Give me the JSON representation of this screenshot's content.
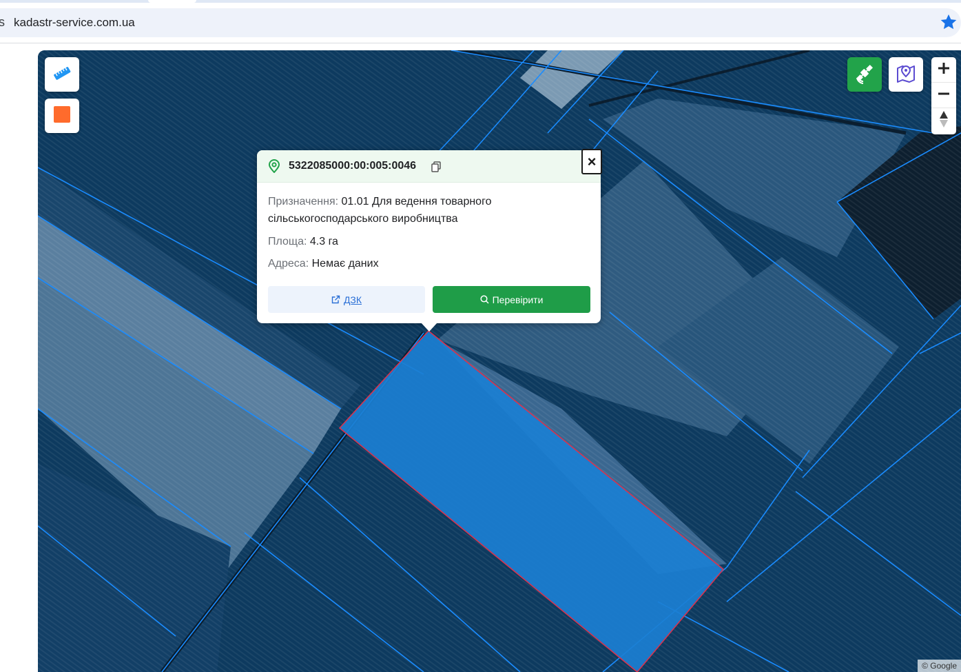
{
  "browser": {
    "address_fragment": "s",
    "url": "kadastr-service.com.ua"
  },
  "map": {
    "attribution": "© Google",
    "controls": {
      "measure_icon": "ruler-icon",
      "draw_icon": "square-icon",
      "satellite_icon": "satellite-icon",
      "map_layer_icon": "map-pin-icon",
      "zoom_in_icon": "plus-icon",
      "zoom_out_icon": "minus-icon",
      "compass_icon": "compass-icon"
    },
    "colors": {
      "selected_parcel": "#1b7fd3",
      "parcel_lines": "#1a8cff",
      "selected_outline": "#e0304a"
    }
  },
  "popup": {
    "cadastral_number": "5322085000:00:005:0046",
    "close_label": "×",
    "purpose_label": "Призначення:",
    "purpose_value": "01.01 Для ведення товарного сільськогосподарського виробництва",
    "area_label": "Площа:",
    "area_value": "4.3 га",
    "address_label": "Адреса:",
    "address_value": "Немає даних",
    "dzk_button": "ДЗК",
    "check_button": "Перевірити"
  }
}
